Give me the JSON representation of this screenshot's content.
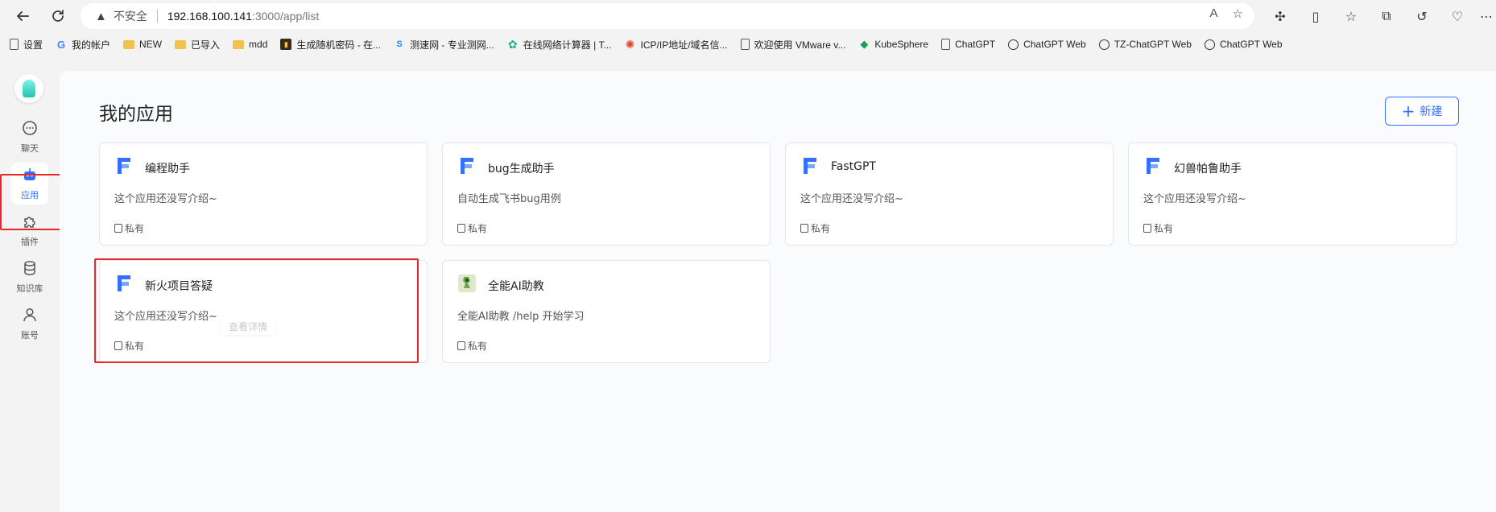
{
  "browser": {
    "security_label": "不安全",
    "url_host": "192.168.100.141",
    "url_path": ":3000/app/list"
  },
  "bookmarks": [
    {
      "label": "设置",
      "icon": "page-icon"
    },
    {
      "label": "我的帐户",
      "icon": "google-icon"
    },
    {
      "label": "NEW",
      "icon": "folder-icon"
    },
    {
      "label": "已导入",
      "icon": "folder-icon"
    },
    {
      "label": "mdd",
      "icon": "folder-icon"
    },
    {
      "label": "生成随机密码 - 在...",
      "icon": "password-icon"
    },
    {
      "label": "测速网 - 专业测网...",
      "icon": "speedtest-icon"
    },
    {
      "label": "在线网络计算器 | T...",
      "icon": "gear-icon"
    },
    {
      "label": "ICP/IP地址/域名信...",
      "icon": "swirl-icon"
    },
    {
      "label": "欢迎使用 VMware v...",
      "icon": "page-icon"
    },
    {
      "label": "KubeSphere",
      "icon": "kubesphere-icon"
    },
    {
      "label": "ChatGPT",
      "icon": "page-icon"
    },
    {
      "label": "ChatGPT Web",
      "icon": "openai-icon"
    },
    {
      "label": "TZ-ChatGPT Web",
      "icon": "openai-icon"
    },
    {
      "label": "ChatGPT Web",
      "icon": "openai-icon"
    }
  ],
  "sidebar": {
    "items": [
      {
        "label": "聊天",
        "icon": "chat-icon"
      },
      {
        "label": "应用",
        "icon": "robot-icon",
        "active": true
      },
      {
        "label": "插件",
        "icon": "puzzle-icon"
      },
      {
        "label": "知识库",
        "icon": "database-icon"
      },
      {
        "label": "账号",
        "icon": "user-icon"
      }
    ]
  },
  "main": {
    "title": "我的应用",
    "new_button": "新建",
    "tooltip": "查看详情"
  },
  "apps": [
    {
      "name": "编程助手",
      "desc": "这个应用还没写介绍~",
      "privacy": "私有",
      "icon": "fastgpt-icon"
    },
    {
      "name": "bug生成助手",
      "desc": "自动生成飞书bug用例",
      "privacy": "私有",
      "icon": "fastgpt-icon"
    },
    {
      "name": "FastGPT",
      "desc": "这个应用还没写介绍~",
      "privacy": "私有",
      "icon": "fastgpt-icon"
    },
    {
      "name": "幻兽帕鲁助手",
      "desc": "这个应用还没写介绍~",
      "privacy": "私有",
      "icon": "fastgpt-icon"
    },
    {
      "name": "新火项目答疑",
      "desc": "这个应用还没写介绍~",
      "privacy": "私有",
      "icon": "fastgpt-icon"
    },
    {
      "name": "全能AI助教",
      "desc": "全能AI助教 /help 开始学习",
      "privacy": "私有",
      "icon": "avatar-image-icon"
    }
  ],
  "colors": {
    "accent": "#3370ff",
    "highlight": "#e8262b"
  }
}
